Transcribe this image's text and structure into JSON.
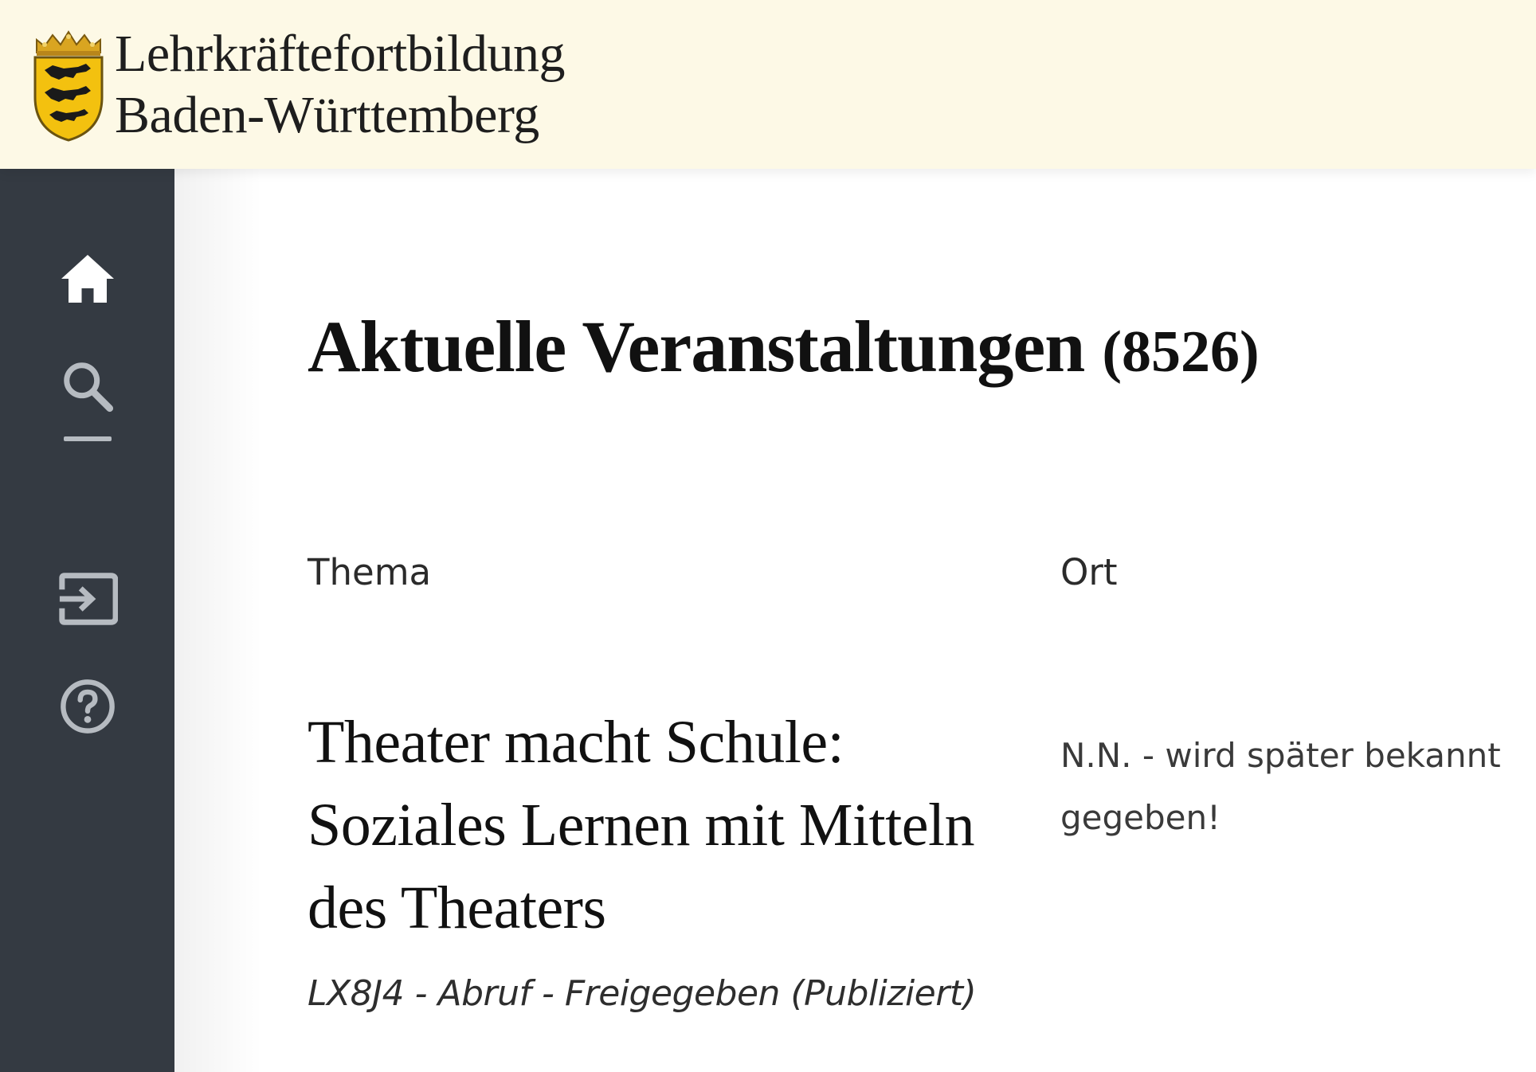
{
  "header": {
    "title_line1": "Lehrkräftefortbildung",
    "title_line2": "Baden-Württemberg",
    "logo": "baden-wuerttemberg-coat-of-arms"
  },
  "sidebar": {
    "items": [
      {
        "icon": "home-icon",
        "label": "Startseite"
      },
      {
        "icon": "search-icon",
        "label": "Suche"
      },
      {
        "icon": "divider"
      },
      {
        "icon": "login-icon",
        "label": "Anmelden"
      },
      {
        "icon": "help-icon",
        "label": "Hilfe"
      }
    ]
  },
  "main": {
    "title": "Aktuelle Veranstaltungen",
    "count": "(8526)",
    "columns": {
      "thema": "Thema",
      "ort": "Ort"
    },
    "events": [
      {
        "title": "Theater macht Schule: Soziales Lernen mit Mitteln des Theaters",
        "meta": "LX8J4 - Abruf - Freigegeben (Publiziert)",
        "ort": "N.N. - wird später bekannt gegeben!"
      }
    ]
  },
  "colors": {
    "header_bg": "#fdf9e6",
    "sidebar_bg": "#343a42",
    "active_icon": "#ffffff",
    "inactive_icon": "#b6bbc1"
  }
}
